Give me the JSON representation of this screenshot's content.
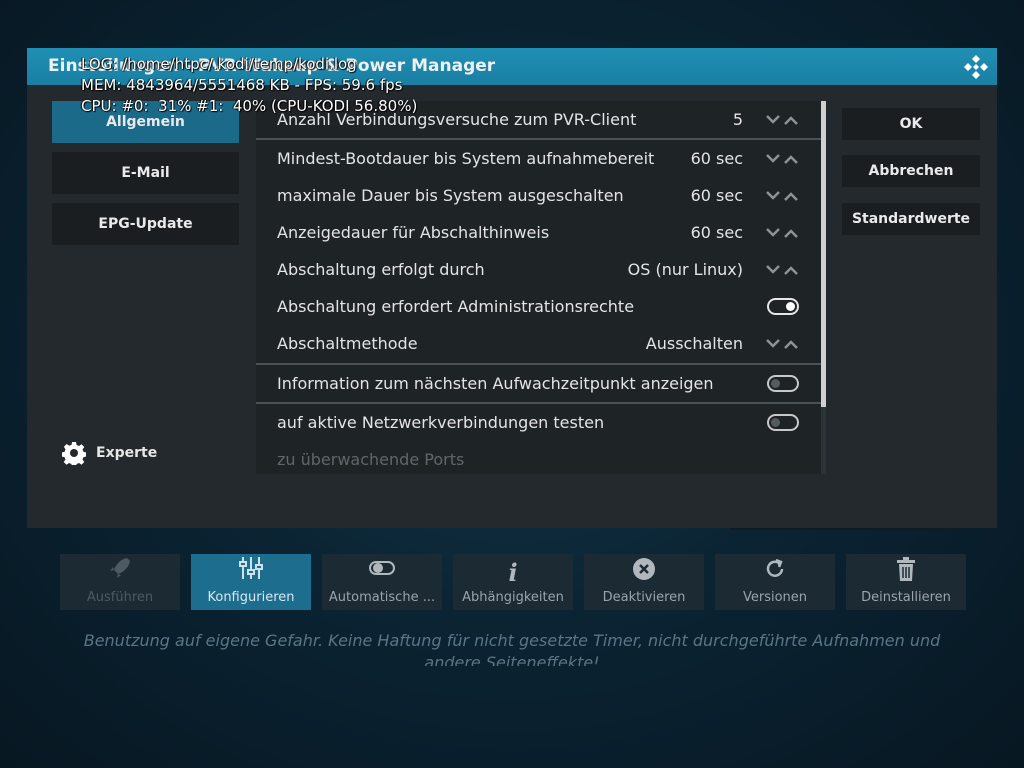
{
  "background": {
    "toolbar": [
      {
        "label": "Ausführen",
        "icon": "rocket-icon"
      },
      {
        "label": "Konfigurieren",
        "icon": "sliders-icon"
      },
      {
        "label": "Automatische ...",
        "icon": "toggle-icon"
      },
      {
        "label": "Abhängigkeiten",
        "icon": "info-icon"
      },
      {
        "label": "Deaktivieren",
        "icon": "close-circle-icon"
      },
      {
        "label": "Versionen",
        "icon": "refresh-icon"
      },
      {
        "label": "Deinstallieren",
        "icon": "trash-icon"
      }
    ],
    "disclaimer": "Benutzung auf eigene Gefahr. Keine Haftung für nicht gesetzte Timer, nicht durchgeführte Aufnahmen und andere Seiteneffekte!"
  },
  "dialog": {
    "title": "Einstellungen - PVR Wakeup & Power Manager",
    "categories": [
      {
        "label": "Allgemein",
        "active": true
      },
      {
        "label": "E-Mail",
        "active": false
      },
      {
        "label": "EPG-Update",
        "active": false
      }
    ],
    "level_label": "Experte",
    "settings": [
      {
        "label": "Anzahl Verbindungsversuche zum PVR-Client",
        "value": "5",
        "control": "spinner"
      },
      {
        "label": "Mindest-Bootdauer bis System aufnahmebereit",
        "value": "60 sec",
        "control": "spinner"
      },
      {
        "label": "maximale Dauer bis System ausgeschalten",
        "value": "60 sec",
        "control": "spinner"
      },
      {
        "label": "Anzeigedauer für Abschalthinweis",
        "value": "60 sec",
        "control": "spinner"
      },
      {
        "label": "Abschaltung erfolgt durch",
        "value": "OS (nur Linux)",
        "control": "spinner"
      },
      {
        "label": "Abschaltung erfordert Administrationsrechte",
        "value": "on",
        "control": "toggle"
      },
      {
        "label": "Abschaltmethode",
        "value": "Ausschalten",
        "control": "spinner"
      },
      {
        "label": "Information zum nächsten Aufwachzeitpunkt anzeigen",
        "value": "off",
        "control": "toggle"
      },
      {
        "label": "auf aktive Netzwerkverbindungen testen",
        "value": "off",
        "control": "toggle"
      },
      {
        "label": "zu überwachende Ports",
        "value": "",
        "control": "none"
      }
    ],
    "buttons": {
      "ok": "OK",
      "cancel": "Abbrechen",
      "defaults": "Standardwerte"
    }
  },
  "debug_overlay": {
    "log": "LOG: /home/htpc/.kodi/temp/kodi.log",
    "mem": "MEM: 4843964/5551468 KB - FPS: 59.6 fps",
    "cpu": "CPU: #0:  31% #1:  40% (CPU-KODI 56.80%)"
  },
  "colors": {
    "accent": "#1f8db2",
    "active_item": "#1c6a8a",
    "panel": "#23292c"
  }
}
